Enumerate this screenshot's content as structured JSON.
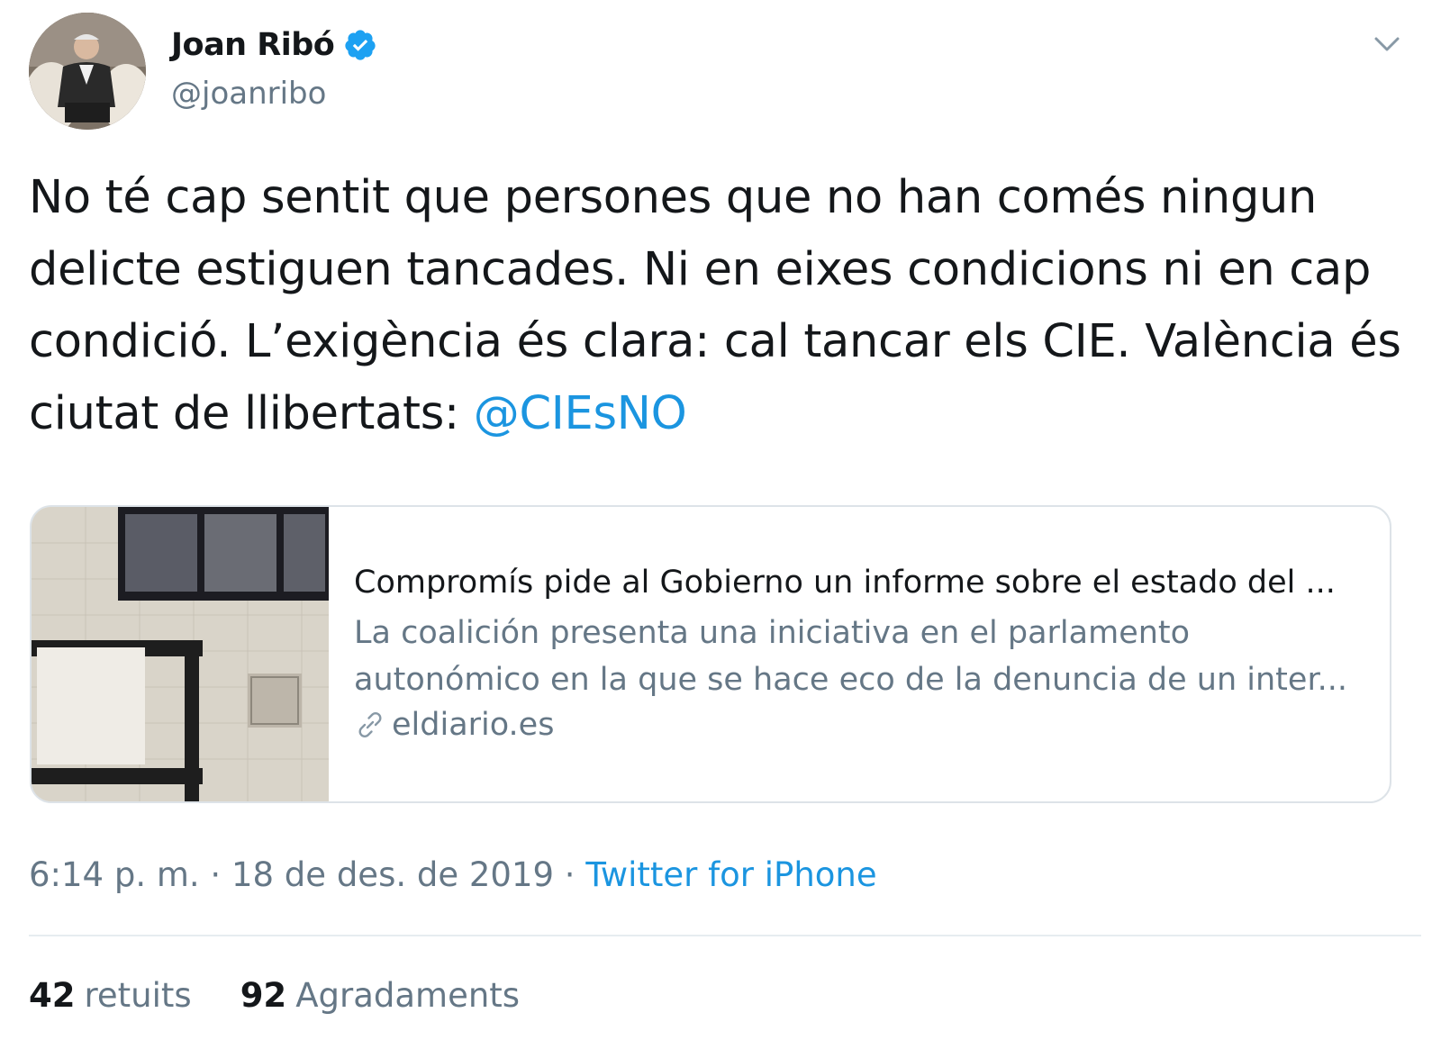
{
  "user": {
    "display_name": "Joan Ribó",
    "handle": "@joanribo"
  },
  "tweet": {
    "text_main": "No té cap sentit que persones que no han comés ningun delicte estiguen tancades. Ni en eixes condicions ni en cap condició. L’exigència és clara: cal tancar els CIE. València és ciutat de llibertats: ",
    "mention": "@CIEsNO"
  },
  "card": {
    "title": "Compromís pide al Gobierno un informe sobre el estado del ...",
    "description": "La coalición presenta una iniciativa en el parlamento autonómico en la que se hace eco de la denuncia de un inter...",
    "domain": "eldiario.es"
  },
  "meta": {
    "time": "6:14 p. m.",
    "separator1": " · ",
    "date": "18 de des. de 2019",
    "separator2": " · ",
    "source": "Twitter for iPhone"
  },
  "stats": {
    "retweets_count": "42",
    "retweets_label": "retuits",
    "likes_count": "92",
    "likes_label": "Agradaments"
  },
  "colors": {
    "link": "#1b95e0",
    "secondary_text": "#657786",
    "verified": "#1da1f2"
  },
  "icons": [
    "verified-badge-icon",
    "chevron-down-icon",
    "link-icon"
  ]
}
